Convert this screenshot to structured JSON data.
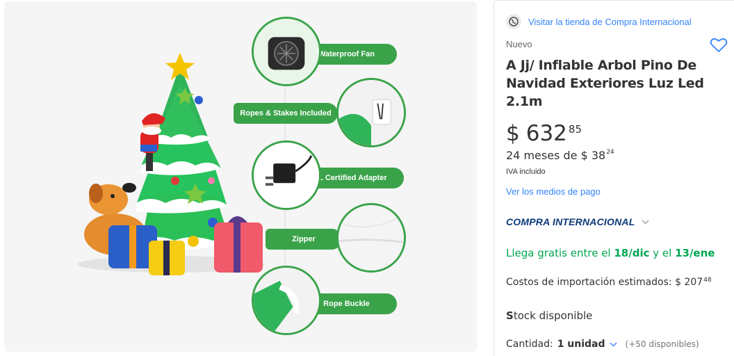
{
  "gallery": {
    "features": [
      {
        "label": "Waterproof  Fan",
        "icon": "fan-icon"
      },
      {
        "label": "Ropes & Stakes Included",
        "icon": "rope-icon"
      },
      {
        "label": "UL Certified Adapter",
        "icon": "adapter-icon"
      },
      {
        "label": "Zipper",
        "icon": "zipper-icon"
      },
      {
        "label": "Rope Buckle",
        "icon": "buckle-icon"
      }
    ],
    "colors": {
      "pill": "#3aa34a",
      "background": "#f5f5f5"
    }
  },
  "product": {
    "store_link": "Visitar la tienda de Compra Internacional",
    "condition": "Nuevo",
    "title": "A Jj/ Inflable Arbol Pino De Navidad Exteriores Luz Led 2.1m",
    "price": {
      "currency": "$",
      "main": "632",
      "cents": "85"
    },
    "installments": {
      "text": "24 meses de $ 38",
      "cents": "24"
    },
    "tax_note": "IVA incluido",
    "payment_link": "Ver los medios de pago",
    "international_label": "COMPRA INTERNACIONAL",
    "shipping": {
      "prefix": "Llega gratis entre el ",
      "from": "18/dic",
      "mid": " y el ",
      "to": "13/ene"
    },
    "import_cost": {
      "text": "Costos de importación estimados: $ 207",
      "cents": "48"
    },
    "stock": {
      "first": "S",
      "rest": "tock disponible"
    },
    "quantity": {
      "label": "Cantidad: ",
      "value": "1 unidad",
      "available": "(+50 disponibles)"
    },
    "colors": {
      "link": "#3483fa",
      "shipping": "#00a650",
      "intl": "#0c3a7a"
    }
  }
}
